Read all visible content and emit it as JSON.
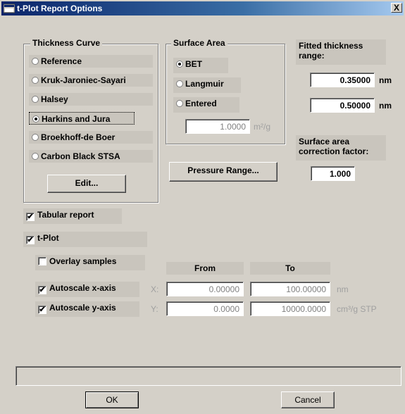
{
  "window": {
    "title": "t-Plot Report Options",
    "close_glyph": "X",
    "icon": "window-icon"
  },
  "thickness_curve": {
    "legend": "Thickness Curve",
    "options": [
      {
        "label": "Reference",
        "selected": false
      },
      {
        "label": "Kruk-Jaroniec-Sayari",
        "selected": false
      },
      {
        "label": "Halsey",
        "selected": false
      },
      {
        "label": "Harkins and Jura",
        "selected": true
      },
      {
        "label": "Broekhoff-de Boer",
        "selected": false
      },
      {
        "label": "Carbon Black STSA",
        "selected": false
      }
    ],
    "edit_label": "Edit..."
  },
  "surface_area": {
    "legend": "Surface Area",
    "options": [
      {
        "label": "BET",
        "selected": true
      },
      {
        "label": "Langmuir",
        "selected": false
      },
      {
        "label": "Entered",
        "selected": false
      }
    ],
    "entered_value": "1.0000",
    "entered_unit": "m²/g"
  },
  "pressure_range_label": "Pressure Range...",
  "fitted_thickness": {
    "label": "Fitted thickness range:",
    "min_value": "0.35000",
    "max_value": "0.50000",
    "unit": "nm"
  },
  "correction_factor": {
    "label": "Surface area correction factor:",
    "value": "1.000"
  },
  "tabular_report": {
    "label": "Tabular report",
    "checked": true
  },
  "tplot": {
    "label": "t-Plot",
    "checked": true
  },
  "overlay_samples": {
    "label": "Overlay samples",
    "checked": false
  },
  "axes": {
    "from_header": "From",
    "to_header": "To",
    "x": {
      "label": "Autoscale x-axis",
      "checked": true,
      "axis": "X:",
      "from": "0.00000",
      "to": "100.00000",
      "unit": "nm"
    },
    "y": {
      "label": "Autoscale y-axis",
      "checked": true,
      "axis": "Y:",
      "from": "0.0000",
      "to": "10000.0000",
      "unit": "cm³/g STP"
    }
  },
  "status_text": "",
  "ok_label": "OK",
  "cancel_label": "Cancel"
}
